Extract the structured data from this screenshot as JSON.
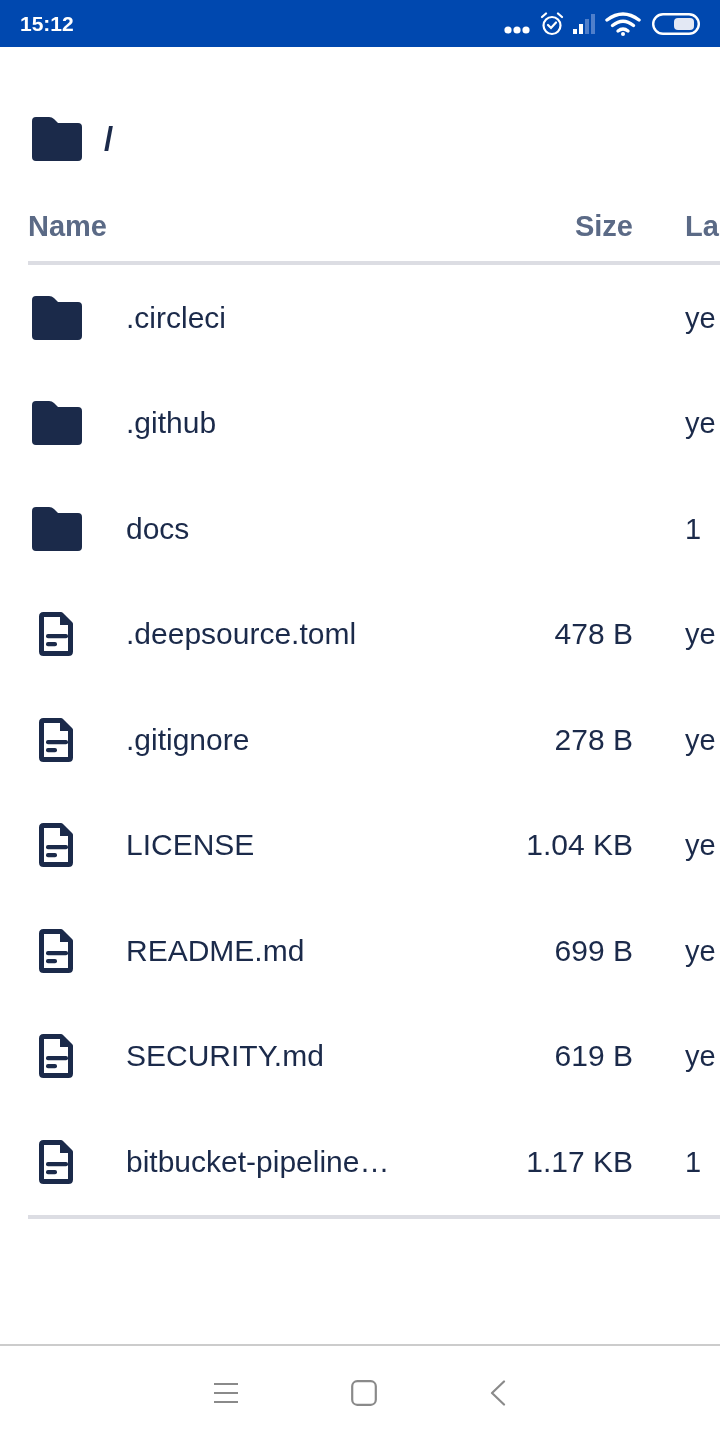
{
  "status_bar": {
    "time": "15:12"
  },
  "breadcrumb": {
    "path": "/"
  },
  "table": {
    "columns": [
      "Name",
      "Size",
      "La"
    ],
    "rows": [
      {
        "kind": "folder",
        "name": ".circleci",
        "column_3": "ye"
      },
      {
        "kind": "folder",
        "name": ".github",
        "column_3": "ye"
      },
      {
        "kind": "folder",
        "name": "docs",
        "column_3": "1"
      },
      {
        "kind": "file",
        "name": ".deepsource.toml",
        "size": "478 B",
        "column_3": "ye"
      },
      {
        "kind": "file",
        "name": ".gitignore",
        "size": "278 B",
        "column_3": "ye"
      },
      {
        "kind": "file",
        "name": "LICENSE",
        "size": "1.04 KB",
        "column_3": "ye"
      },
      {
        "kind": "file",
        "name": "README.md",
        "size": "699 B",
        "column_3": "ye"
      },
      {
        "kind": "file",
        "name": "SECURITY.md",
        "size": "619 B",
        "column_3": "ye"
      },
      {
        "kind": "file",
        "name": "bitbucket-pipeline…",
        "size": "1.17 KB",
        "column_3": "1"
      }
    ]
  }
}
